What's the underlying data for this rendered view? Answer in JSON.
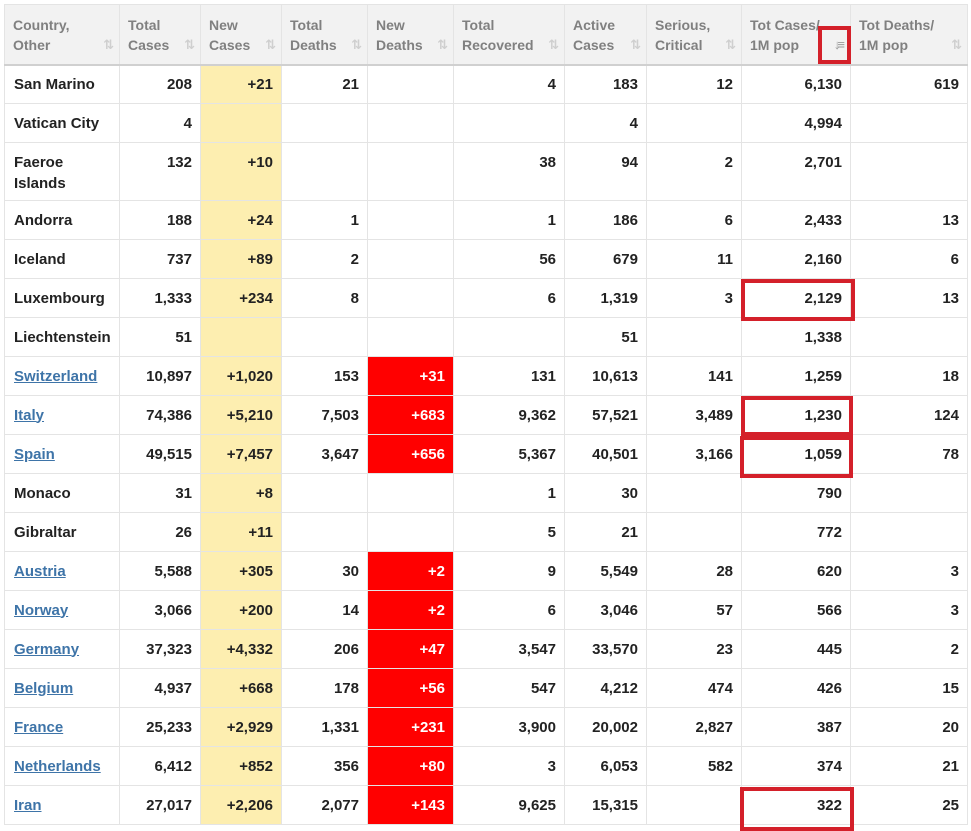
{
  "columns": [
    {
      "line1": "Country,",
      "line2": "Other"
    },
    {
      "line1": "Total",
      "line2": "Cases"
    },
    {
      "line1": "New",
      "line2": "Cases"
    },
    {
      "line1": "Total",
      "line2": "Deaths"
    },
    {
      "line1": "New",
      "line2": "Deaths"
    },
    {
      "line1": "Total",
      "line2": "Recovered"
    },
    {
      "line1": "Active",
      "line2": "Cases"
    },
    {
      "line1": "Serious,",
      "line2": "Critical"
    },
    {
      "line1": "Tot Cases/",
      "line2": "1M pop"
    },
    {
      "line1": "Tot Deaths/",
      "line2": "1M pop"
    }
  ],
  "sort_icon": "⇅",
  "sorted_icon": "↓≡",
  "colors": {
    "new_cases_bg": "#fdeeb0",
    "new_deaths_bg": "#ff0000",
    "link": "#3e74a8",
    "highlight": "#d4202a"
  },
  "rows": [
    {
      "country": "San Marino",
      "link": false,
      "total_cases": "208",
      "new_cases": "+21",
      "total_deaths": "21",
      "new_deaths": "",
      "total_recovered": "4",
      "active_cases": "183",
      "serious": "12",
      "cases_per_1m": "6,130",
      "deaths_per_1m": "619"
    },
    {
      "country": "Vatican City",
      "link": false,
      "total_cases": "4",
      "new_cases": "",
      "total_deaths": "",
      "new_deaths": "",
      "total_recovered": "",
      "active_cases": "4",
      "serious": "",
      "cases_per_1m": "4,994",
      "deaths_per_1m": ""
    },
    {
      "country": "Faeroe Islands",
      "link": false,
      "total_cases": "132",
      "new_cases": "+10",
      "total_deaths": "",
      "new_deaths": "",
      "total_recovered": "38",
      "active_cases": "94",
      "serious": "2",
      "cases_per_1m": "2,701",
      "deaths_per_1m": ""
    },
    {
      "country": "Andorra",
      "link": false,
      "total_cases": "188",
      "new_cases": "+24",
      "total_deaths": "1",
      "new_deaths": "",
      "total_recovered": "1",
      "active_cases": "186",
      "serious": "6",
      "cases_per_1m": "2,433",
      "deaths_per_1m": "13"
    },
    {
      "country": "Iceland",
      "link": false,
      "total_cases": "737",
      "new_cases": "+89",
      "total_deaths": "2",
      "new_deaths": "",
      "total_recovered": "56",
      "active_cases": "679",
      "serious": "11",
      "cases_per_1m": "2,160",
      "deaths_per_1m": "6"
    },
    {
      "country": "Luxembourg",
      "link": false,
      "total_cases": "1,333",
      "new_cases": "+234",
      "total_deaths": "8",
      "new_deaths": "",
      "total_recovered": "6",
      "active_cases": "1,319",
      "serious": "3",
      "cases_per_1m": "2,129",
      "deaths_per_1m": "13"
    },
    {
      "country": "Liechtenstein",
      "link": false,
      "total_cases": "51",
      "new_cases": "",
      "total_deaths": "",
      "new_deaths": "",
      "total_recovered": "",
      "active_cases": "51",
      "serious": "",
      "cases_per_1m": "1,338",
      "deaths_per_1m": ""
    },
    {
      "country": "Switzerland",
      "link": true,
      "total_cases": "10,897",
      "new_cases": "+1,020",
      "total_deaths": "153",
      "new_deaths": "+31",
      "total_recovered": "131",
      "active_cases": "10,613",
      "serious": "141",
      "cases_per_1m": "1,259",
      "deaths_per_1m": "18"
    },
    {
      "country": "Italy",
      "link": true,
      "total_cases": "74,386",
      "new_cases": "+5,210",
      "total_deaths": "7,503",
      "new_deaths": "+683",
      "total_recovered": "9,362",
      "active_cases": "57,521",
      "serious": "3,489",
      "cases_per_1m": "1,230",
      "deaths_per_1m": "124"
    },
    {
      "country": "Spain",
      "link": true,
      "total_cases": "49,515",
      "new_cases": "+7,457",
      "total_deaths": "3,647",
      "new_deaths": "+656",
      "total_recovered": "5,367",
      "active_cases": "40,501",
      "serious": "3,166",
      "cases_per_1m": "1,059",
      "deaths_per_1m": "78"
    },
    {
      "country": "Monaco",
      "link": false,
      "total_cases": "31",
      "new_cases": "+8",
      "total_deaths": "",
      "new_deaths": "",
      "total_recovered": "1",
      "active_cases": "30",
      "serious": "",
      "cases_per_1m": "790",
      "deaths_per_1m": ""
    },
    {
      "country": "Gibraltar",
      "link": false,
      "total_cases": "26",
      "new_cases": "+11",
      "total_deaths": "",
      "new_deaths": "",
      "total_recovered": "5",
      "active_cases": "21",
      "serious": "",
      "cases_per_1m": "772",
      "deaths_per_1m": ""
    },
    {
      "country": "Austria",
      "link": true,
      "total_cases": "5,588",
      "new_cases": "+305",
      "total_deaths": "30",
      "new_deaths": "+2",
      "total_recovered": "9",
      "active_cases": "5,549",
      "serious": "28",
      "cases_per_1m": "620",
      "deaths_per_1m": "3"
    },
    {
      "country": "Norway",
      "link": true,
      "total_cases": "3,066",
      "new_cases": "+200",
      "total_deaths": "14",
      "new_deaths": "+2",
      "total_recovered": "6",
      "active_cases": "3,046",
      "serious": "57",
      "cases_per_1m": "566",
      "deaths_per_1m": "3"
    },
    {
      "country": "Germany",
      "link": true,
      "total_cases": "37,323",
      "new_cases": "+4,332",
      "total_deaths": "206",
      "new_deaths": "+47",
      "total_recovered": "3,547",
      "active_cases": "33,570",
      "serious": "23",
      "cases_per_1m": "445",
      "deaths_per_1m": "2"
    },
    {
      "country": "Belgium",
      "link": true,
      "total_cases": "4,937",
      "new_cases": "+668",
      "total_deaths": "178",
      "new_deaths": "+56",
      "total_recovered": "547",
      "active_cases": "4,212",
      "serious": "474",
      "cases_per_1m": "426",
      "deaths_per_1m": "15"
    },
    {
      "country": "France",
      "link": true,
      "total_cases": "25,233",
      "new_cases": "+2,929",
      "total_deaths": "1,331",
      "new_deaths": "+231",
      "total_recovered": "3,900",
      "active_cases": "20,002",
      "serious": "2,827",
      "cases_per_1m": "387",
      "deaths_per_1m": "20"
    },
    {
      "country": "Netherlands",
      "link": true,
      "total_cases": "6,412",
      "new_cases": "+852",
      "total_deaths": "356",
      "new_deaths": "+80",
      "total_recovered": "3",
      "active_cases": "6,053",
      "serious": "582",
      "cases_per_1m": "374",
      "deaths_per_1m": "21"
    },
    {
      "country": "Iran",
      "link": true,
      "total_cases": "27,017",
      "new_cases": "+2,206",
      "total_deaths": "2,077",
      "new_deaths": "+143",
      "total_recovered": "9,625",
      "active_cases": "15,315",
      "serious": "",
      "cases_per_1m": "322",
      "deaths_per_1m": "25"
    }
  ]
}
